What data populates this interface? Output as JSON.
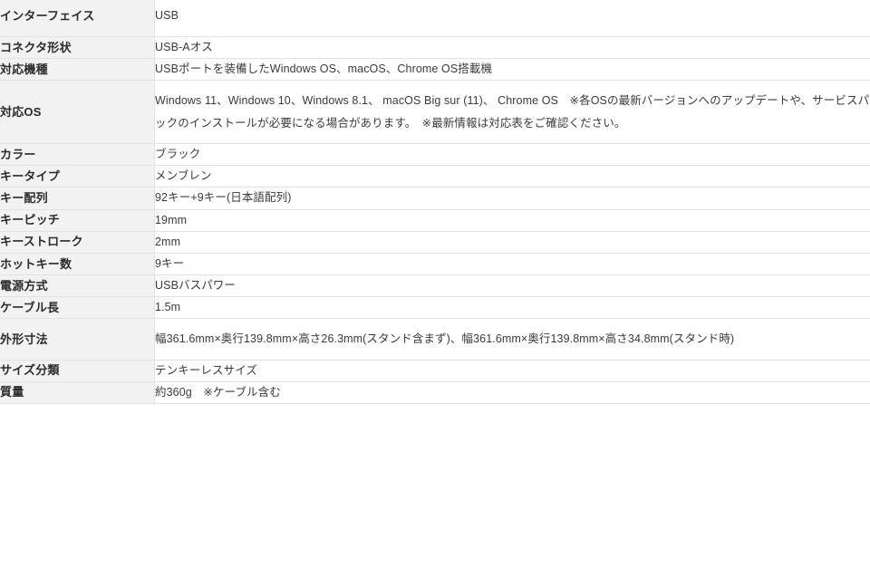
{
  "table": {
    "rows": [
      {
        "label": "インターフェイス",
        "value": "USB"
      },
      {
        "label": "コネクタ形状",
        "value": "USB-Aオス"
      },
      {
        "label": "対応機種",
        "value": "USBポートを装備したWindows OS、macOS、Chrome OS搭載機"
      },
      {
        "label": "対応OS",
        "value": "Windows 11、Windows 10、Windows 8.1、 macOS Big sur (11)、 Chrome OS　※各OSの最新バージョンへのアップデートや、サービスパックのインストールが必要になる場合があります。　※最新情報は対応表をご確認ください。"
      },
      {
        "label": "カラー",
        "value": "ブラック"
      },
      {
        "label": "キータイプ",
        "value": "メンブレン"
      },
      {
        "label": "キー配列",
        "value": "92キー+9キー(日本語配列)"
      },
      {
        "label": "キーピッチ",
        "value": "19mm"
      },
      {
        "label": "キーストローク",
        "value": "2mm"
      },
      {
        "label": "ホットキー数",
        "value": "9キー"
      },
      {
        "label": "電源方式",
        "value": "USBバスパワー"
      },
      {
        "label": "ケーブル長",
        "value": "1.5m"
      },
      {
        "label": "外形寸法",
        "value": "幅361.6mm×奥行139.8mm×高さ26.3mm(スタンド含まず)、幅361.6mm×奥行139.8mm×高さ34.8mm(スタンド時)"
      },
      {
        "label": "サイズ分類",
        "value": "テンキーレスサイズ"
      },
      {
        "label": "質量",
        "value": "約360g　※ケーブル含む"
      }
    ]
  },
  "colors": {
    "label_background": "#f2f2f2",
    "value_background": "#ffffff",
    "border": "#e2e2e2",
    "label_text": "#2b2b2b",
    "value_text": "#3a3a3a"
  }
}
